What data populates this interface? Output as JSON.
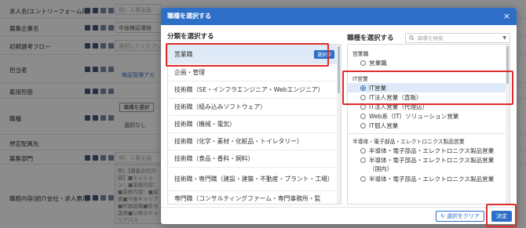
{
  "background_form": {
    "rows": [
      {
        "label": "求人名(エントリーフォーム用)",
        "placeholder": "例）人事企画"
      },
      {
        "label": "募集企業名",
        "value": "中途検証環境"
      },
      {
        "label": "初期選考フロー",
        "placeholder": "選択してください"
      },
      {
        "label": "担当者",
        "link": "検証管理アカ"
      },
      {
        "label": "雇用形態"
      },
      {
        "label": "職種",
        "button": "職種を選択",
        "status": "選択なし"
      },
      {
        "label": "想定配属先"
      },
      {
        "label": "募集部門",
        "placeholder": "例）人事企画"
      },
      {
        "label": "職務内容(紹介会社・求人票用)",
        "textarea": "例）【募集合社内容】■ミッション：■業務内容：■業務内容：■組織■今後キャリア■所属組織■担当業務■以降のキャリアパス"
      }
    ]
  },
  "modal": {
    "title": "職種を選択する",
    "close_icon": "close-icon",
    "left_title": "分類を選択する",
    "right_title": "職種を選択する",
    "search_placeholder": "職種を検索",
    "selected_badge": "選択中",
    "categories": [
      "営業職",
      "企画・管理",
      "技術職（SE・インフラエンジニア・Webエンジニア）",
      "技術職（組み込みソフトウェア）",
      "技術職（機械・電気）",
      "技術職（化学・素材・化粧品・トイレタリー）",
      "技術職（食品・香料・飼料）",
      "技術職・専門職（建設・建築・不動産・プラント・工場）",
      "専門職（コンサルティングファーム・専門事務所・監"
    ],
    "groups": [
      {
        "title": "営業職",
        "options": [
          "営業職"
        ]
      },
      {
        "title": "IT営業",
        "options": [
          "IT営業",
          "IT法人営業（直販）",
          "IT法人営業（代理店）",
          "Web系（IT）ソリューション営業",
          "IT個人営業"
        ]
      },
      {
        "title": "半導体・電子部品・エレクトロニクス製品営業",
        "options": [
          "半導体・電子部品・エレクトロニクス製品営業",
          "半導体・電子部品・エレクトロニクス製品営業（国内）",
          "半導体・電子部品・エレクトロニクス製品営業"
        ]
      }
    ],
    "selected_option": "IT営業",
    "clear_label": "選択をクリア",
    "confirm_label": "決定"
  },
  "colors": {
    "accent": "#2d6fc7",
    "highlight": "#e02a2a"
  }
}
